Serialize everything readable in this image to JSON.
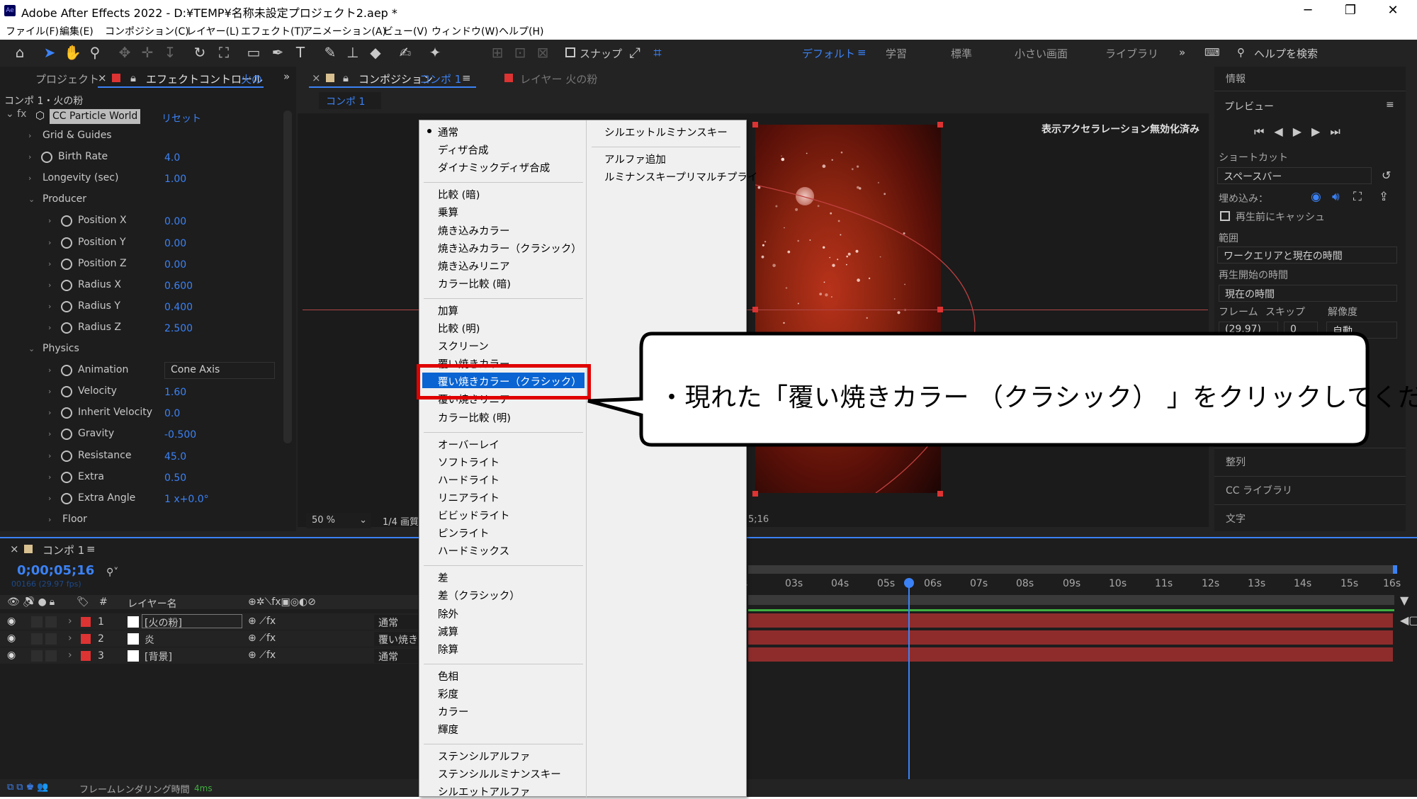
{
  "app": {
    "title": "Adobe After Effects 2022 - D:¥TEMP¥名称未設定プロジェクト2.aep *",
    "logo_text": "Ae"
  },
  "window": {
    "minimize": "─",
    "restore": "❐",
    "close": "✕"
  },
  "menubar": [
    "ファイル(F)",
    "編集(E)",
    "コンポジション(C)",
    "レイヤー(L)",
    "エフェクト(T)",
    "アニメーション(A)",
    "ビュー(V)",
    "ウィンドウ(W)",
    "ヘルプ(H)"
  ],
  "toolbar": {
    "snap_label": "スナップ",
    "workspaces": [
      "デフォルト",
      "学習",
      "標準",
      "小さい画面",
      "ライブラリ"
    ],
    "search_placeholder": "ヘルプを検索"
  },
  "left_panel": {
    "tab_project": "プロジェクト",
    "tab_effect": "エフェクトコントロール",
    "tab_effect_layer": "火の",
    "breadcrumb": "コンポ 1・火の粉",
    "effect_name": "CC Particle World",
    "reset": "リセット",
    "props": [
      {
        "name": "Grid & Guides",
        "value": "",
        "indent": 1,
        "stopwatch": false
      },
      {
        "name": "Birth Rate",
        "value": "4.0",
        "indent": 1,
        "stopwatch": true
      },
      {
        "name": "Longevity (sec)",
        "value": "1.00",
        "indent": 1,
        "stopwatch": false
      },
      {
        "name": "Producer",
        "value": "",
        "indent": 1,
        "stopwatch": false,
        "open": true
      },
      {
        "name": "Position X",
        "value": "0.00",
        "indent": 2,
        "stopwatch": true
      },
      {
        "name": "Position Y",
        "value": "0.00",
        "indent": 2,
        "stopwatch": true
      },
      {
        "name": "Position Z",
        "value": "0.00",
        "indent": 2,
        "stopwatch": true
      },
      {
        "name": "Radius X",
        "value": "0.600",
        "indent": 2,
        "stopwatch": true
      },
      {
        "name": "Radius Y",
        "value": "0.400",
        "indent": 2,
        "stopwatch": true
      },
      {
        "name": "Radius Z",
        "value": "2.500",
        "indent": 2,
        "stopwatch": true
      },
      {
        "name": "Physics",
        "value": "",
        "indent": 1,
        "stopwatch": false,
        "open": true
      },
      {
        "name": "Animation",
        "value": "Cone Axis",
        "indent": 2,
        "stopwatch": true,
        "dropdown": true
      },
      {
        "name": "Velocity",
        "value": "1.60",
        "indent": 2,
        "stopwatch": true
      },
      {
        "name": "Inherit Velocity",
        "value": "0.0",
        "indent": 2,
        "stopwatch": true
      },
      {
        "name": "Gravity",
        "value": "-0.500",
        "indent": 2,
        "stopwatch": true
      },
      {
        "name": "Resistance",
        "value": "45.0",
        "indent": 2,
        "stopwatch": true
      },
      {
        "name": "Extra",
        "value": "0.50",
        "indent": 2,
        "stopwatch": true
      },
      {
        "name": "Extra Angle",
        "value": "1 x+0.0°",
        "indent": 2,
        "stopwatch": true
      },
      {
        "name": "Floor",
        "value": "",
        "indent": 2,
        "stopwatch": false
      }
    ]
  },
  "comp_panel": {
    "tab_label": "コンポジション",
    "tab_comp": "コンポ 1",
    "layer_tab": "レイヤー 火の粉",
    "subtab": "コンポ 1",
    "accel_notice": "表示アクセラレーション無効化済み",
    "zoom": "50 %",
    "resolution": "1/4 画質",
    "timecode_partial": "5;16"
  },
  "blend_menu": {
    "col1": [
      [
        "通常",
        "ディザ合成",
        "ダイナミックディザ合成"
      ],
      [
        "比較 (暗)",
        "乗算",
        "焼き込みカラー",
        "焼き込みカラー（クラシック）",
        "焼き込みリニア",
        "カラー比較 (暗)"
      ],
      [
        "加算",
        "比較 (明)",
        "スクリーン",
        "覆い焼きカラー",
        "覆い焼きカラー（クラシック）",
        "覆い焼きリニア",
        "カラー比較 (明)"
      ],
      [
        "オーバーレイ",
        "ソフトライト",
        "ハードライト",
        "リニアライト",
        "ビビッドライト",
        "ピンライト",
        "ハードミックス"
      ],
      [
        "差",
        "差（クラシック）",
        "除外",
        "減算",
        "除算"
      ],
      [
        "色相",
        "彩度",
        "カラー",
        "輝度"
      ],
      [
        "ステンシルアルファ",
        "ステンシルルミナンスキー",
        "シルエットアルファ"
      ]
    ],
    "col2": [
      [
        "シルエットルミナンスキー"
      ],
      [
        "アルファ追加",
        "ルミナンスキープリマルチプライ"
      ]
    ],
    "selected": "覆い焼きカラー（クラシック）",
    "checked": "通常"
  },
  "callout": {
    "text": "・現れた「覆い焼きカラー （クラシック） 」をクリックしてください"
  },
  "right_panel": {
    "info": "情報",
    "preview": "プレビュー",
    "shortcut_label": "ショートカット",
    "shortcut_value": "スペースバー",
    "embed_label": "埋め込み：",
    "cache_label": "再生前にキャッシュ",
    "range_label": "範囲",
    "range_value": "ワークエリアと現在の時間",
    "start_label": "再生開始の時間",
    "start_value": "現在の時間",
    "frame_label": "フレーム",
    "skip_label": "スキップ",
    "res_label": "解像度",
    "frame_value": "(29.97)",
    "skip_value": "0",
    "res_value": "自動",
    "align": "整列",
    "cc_lib": "CC ライブラリ",
    "text": "文字"
  },
  "timeline": {
    "tab": "コンポ 1",
    "timecode": "0;00;05;16",
    "fps": "00166 (29.97 fps)",
    "col_layer": "レイヤー名",
    "col_num": "#",
    "layers": [
      {
        "num": "1",
        "name": "[火の粉]",
        "mode": "通常"
      },
      {
        "num": "2",
        "name": "炎",
        "mode": "覆い焼き"
      },
      {
        "num": "3",
        "name": "[背景]",
        "mode": "通常"
      }
    ],
    "ruler": [
      "s",
      "03s",
      "04s",
      "05s",
      "06s",
      "07s",
      "08s",
      "09s",
      "10s",
      "11s",
      "12s",
      "13s",
      "14s",
      "15s",
      "16s"
    ],
    "footer": "フレームレンダリング時間",
    "render_time": "4ms"
  },
  "colors": {
    "accent": "#3b82f6",
    "highlight": "#0a64d2",
    "callout_border": "#e00000",
    "bar": "#8e2c2c"
  }
}
